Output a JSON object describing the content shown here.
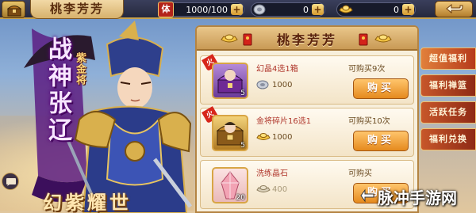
{
  "colors": {
    "accent_gold": "#c7a14d",
    "buy_button": "#e58a1e",
    "hero_purple": "#5b0a7a",
    "side_menu_red": "#8f2a15"
  },
  "topbar": {
    "home_icon": "chest-home-icon",
    "title": "桃李芳芳",
    "stamina": {
      "badge": "体",
      "value": "1000/100",
      "plus": "+"
    },
    "silver": {
      "icon": "silver-coin-icon",
      "value": "0",
      "plus": "+"
    },
    "gold": {
      "icon": "gold-ingot-icon",
      "value": "0",
      "plus": "+"
    },
    "back_icon": "back-arrow-icon"
  },
  "hero": {
    "name": "战神张辽",
    "rank": "紫金将",
    "slogan": "幻紫耀世",
    "chat_icon": "chat-bubble-icon"
  },
  "shop": {
    "title": "桃李芳芳",
    "items": [
      {
        "hot": "火爆",
        "name": "幻晶4选1箱",
        "price": "1000",
        "limit": "可购买9次",
        "count": "5",
        "buy_label": "购买",
        "icon": "purple-hero-chest-icon",
        "price_icon": "silver-coin-icon"
      },
      {
        "hot": "火爆",
        "name": "金将碎片16选1",
        "price": "1000",
        "limit": "可购买10次",
        "count": "5",
        "buy_label": "购买",
        "icon": "gold-shard-chest-icon",
        "price_icon": "gold-ingot-icon"
      },
      {
        "hot": "",
        "name": "洗练晶石",
        "price": "400",
        "limit": "可购买",
        "count": "20",
        "buy_label": "购买",
        "icon": "pink-crystal-icon",
        "price_icon": "gold-ingot-icon"
      }
    ]
  },
  "side_menu": [
    {
      "label": "超值福利",
      "active": true
    },
    {
      "label": "福利禅篮"
    },
    {
      "label": "活跃任务"
    },
    {
      "label": "福利兑换"
    }
  ],
  "watermark": {
    "text": "脉冲手游网",
    "icon": "watermark-logo-icon"
  }
}
